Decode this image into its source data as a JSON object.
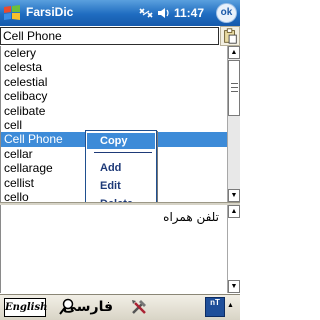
{
  "status_bar": {
    "app_title": "FarsiDic",
    "clock": "11:47",
    "ok_label": "ok",
    "icons": {
      "start": "windows-flag-icon",
      "connectivity": "connectivity-icon",
      "volume": "speaker-icon"
    }
  },
  "search": {
    "value": "Cell Phone"
  },
  "word_list": {
    "items": [
      "celery",
      "celesta",
      "celestial",
      "celibacy",
      "celibate",
      "cell",
      "Cell Phone",
      "cellar",
      "cellarage",
      "cellist",
      "cello"
    ],
    "selected_item": "Cell Phone"
  },
  "context_menu": {
    "items": [
      "Copy",
      "Add",
      "Edit",
      "Delete"
    ],
    "highlighted": "Copy"
  },
  "translation": {
    "text": "تلفن همراه"
  },
  "toolbar": {
    "english_label": "English",
    "farsi_label": "فارسی",
    "keyboard_label": "nT"
  },
  "colors": {
    "title_bar": "#1f6cc0",
    "selection": "#3d8bd8",
    "menu_text": "#1e3a78",
    "toolbar": "#e4e0d4"
  }
}
